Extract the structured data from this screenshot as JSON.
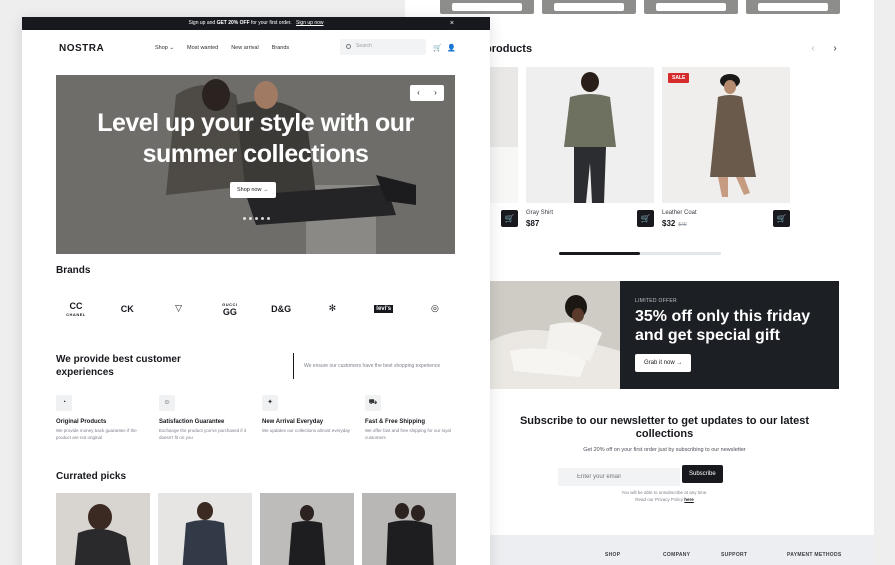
{
  "announcement": {
    "prefix": "Sign up and ",
    "highlight": "GET 20% OFF",
    "middle": " for your first order. ",
    "link": "Sign up now",
    "close": "×"
  },
  "nav": {
    "logo": "NOSTRA",
    "items": [
      "Shop",
      "Most wanted",
      "New arrival",
      "Brands"
    ],
    "search_placeholder": "Search",
    "cart_icon": "🛒",
    "user_icon": "👤"
  },
  "hero": {
    "title": "Level up your style with our summer collections",
    "cta": "Shop now",
    "prev": "‹",
    "next": "›"
  },
  "brands": {
    "title": "Brands",
    "items": [
      {
        "mark": "CC",
        "word": "CHANEL"
      },
      {
        "mark": "CK",
        "word": ""
      },
      {
        "mark": "▽",
        "word": ""
      },
      {
        "mark": "GG",
        "word": "GUCCI"
      },
      {
        "mark": "D&G",
        "word": ""
      },
      {
        "mark": "✻",
        "word": ""
      },
      {
        "mark": "levi's",
        "word": ""
      },
      {
        "mark": "◎",
        "word": ""
      }
    ]
  },
  "experience": {
    "title": "We provide best customer experiences",
    "quote": "We ensure our customers have the best shopping experience",
    "features": [
      {
        "icon": "◔",
        "title": "Original Products",
        "desc": "We provide money back guarantee if the product are not original"
      },
      {
        "icon": "☺",
        "title": "Satisfaction Guarantee",
        "desc": "Exchange the product you've purchased if it doesn't fit on you"
      },
      {
        "icon": "✦",
        "title": "New Arrival Everyday",
        "desc": "We updates our collections almost everyday"
      },
      {
        "icon": "⛟",
        "title": "Fast & Free Shipping",
        "desc": "We offer fast and free shipping for our loyal customers"
      }
    ]
  },
  "picks": {
    "title": "Currated picks"
  },
  "products": {
    "title": "products",
    "prev": "‹",
    "next": "›",
    "items": [
      {
        "name": "",
        "price": "",
        "old_price": "",
        "sale": ""
      },
      {
        "name": "Gray Shirt",
        "price": "$87",
        "old_price": "",
        "sale": ""
      },
      {
        "name": "Leather Coat",
        "price": "$32",
        "old_price": "$40",
        "sale": "SALE"
      }
    ],
    "progress": 0.5
  },
  "offer": {
    "tag": "LIMITED OFFER",
    "title": "35% off only this friday and get special gift",
    "cta": "Grab it now"
  },
  "newsletter": {
    "title": "Subscribe to our newsletter to get updates to our latest collections",
    "subtitle": "Get 20% off on your first order just by subscribing to our newsletter",
    "placeholder": "Enter your email",
    "button": "Subscribe",
    "note": "You will be able to unsubscribe at any time.",
    "note2": "Read our Privacy Policy ",
    "note_link": "here"
  },
  "footer": {
    "cols": [
      "SHOP",
      "COMPANY",
      "SUPPORT",
      "PAYMENT METHODS"
    ]
  }
}
